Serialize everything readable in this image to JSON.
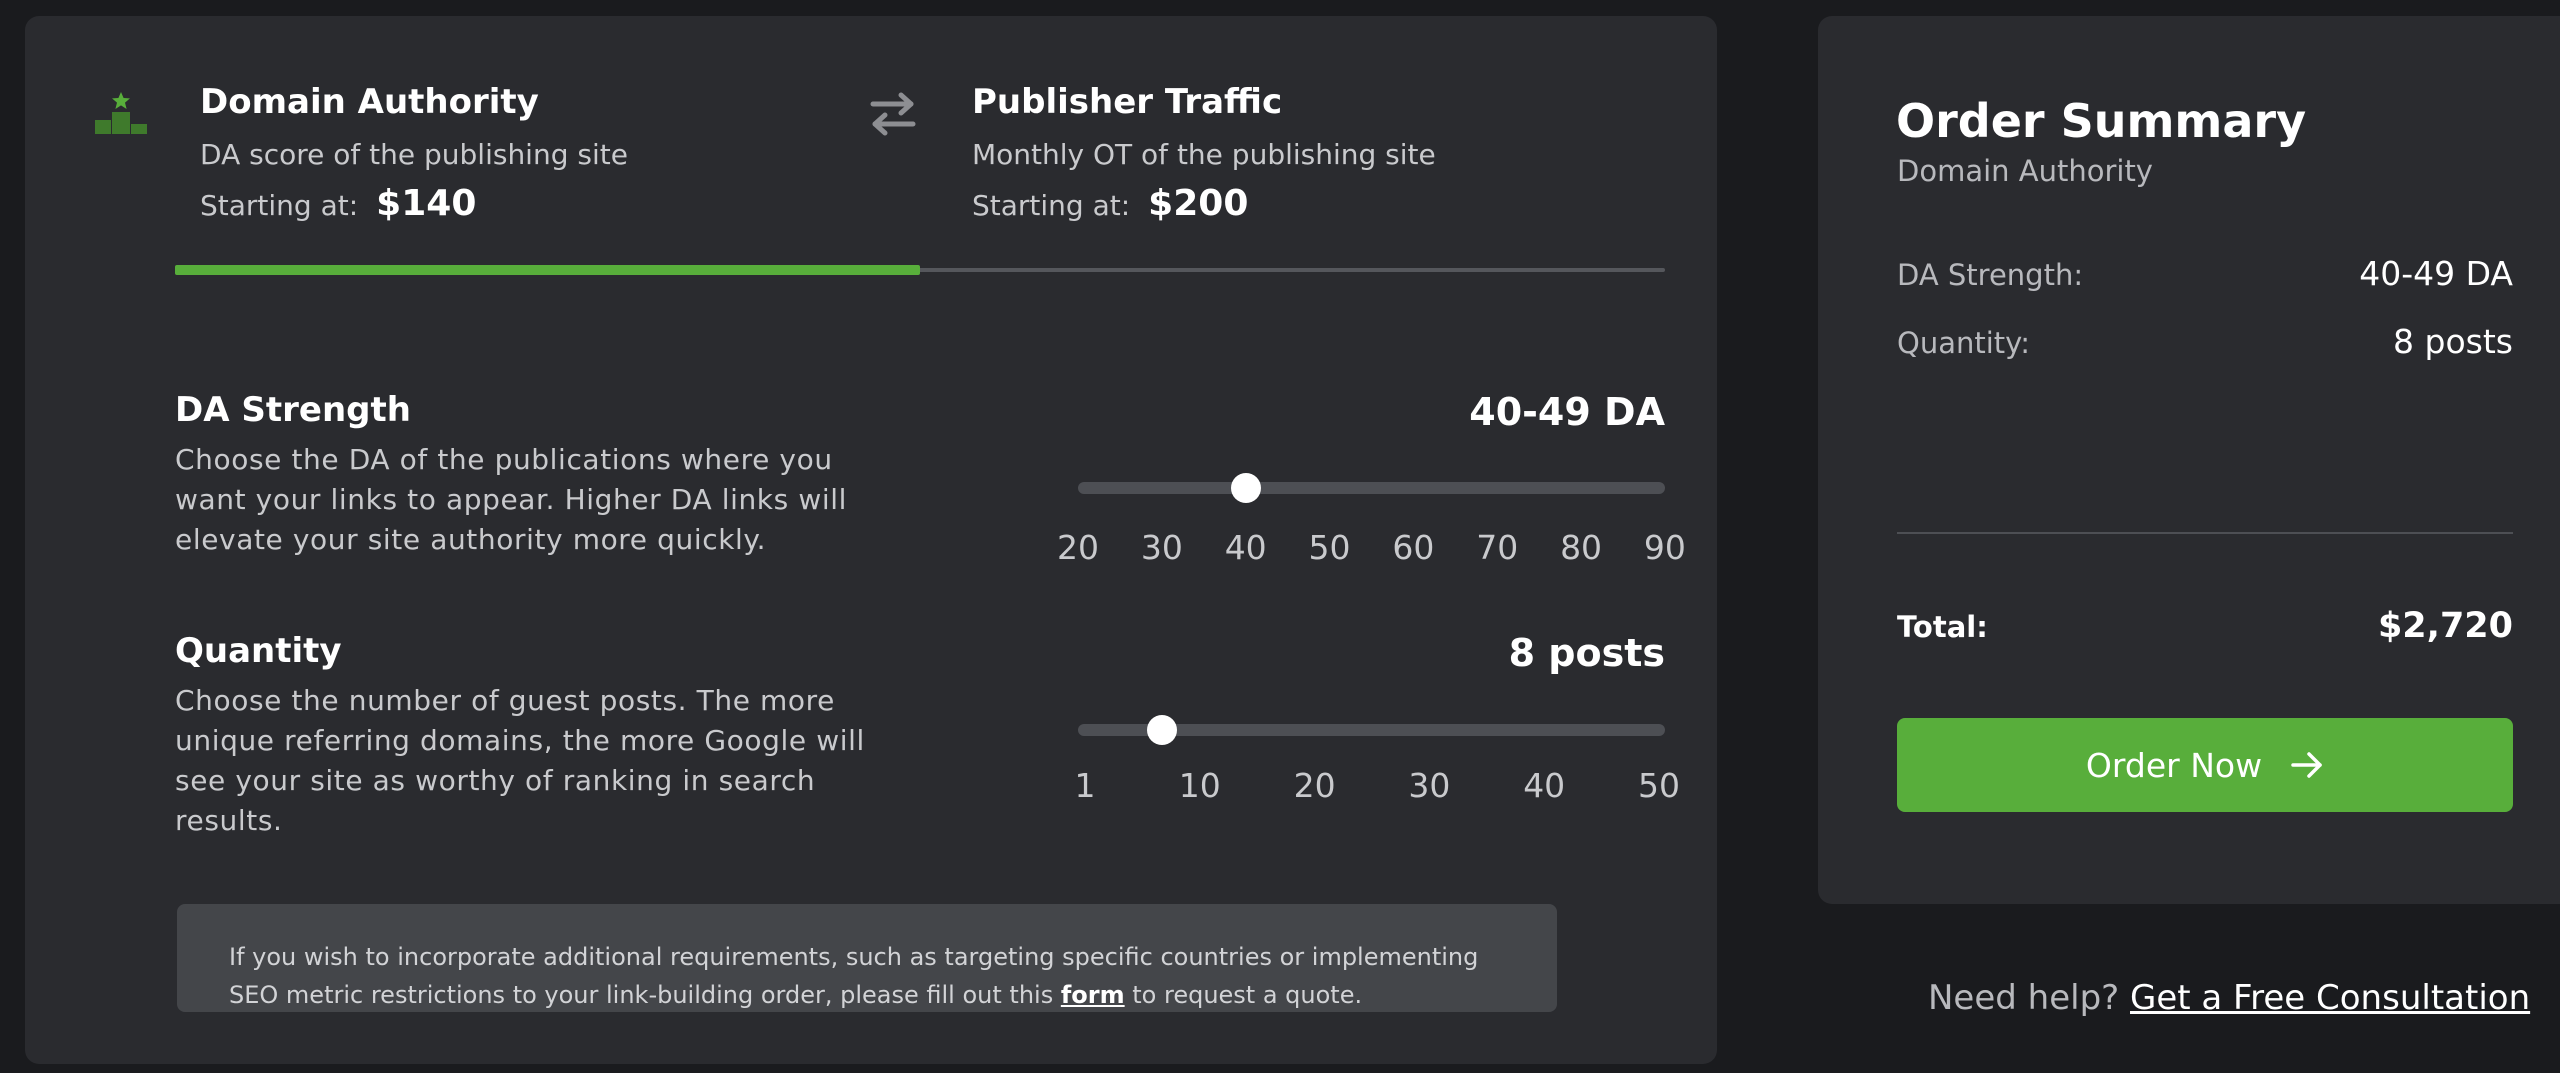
{
  "tabs": [
    {
      "title": "Domain Authority",
      "subtitle": "DA score of the publishing site",
      "price_label": "Starting at:",
      "price": "$140",
      "icon": "podium-star-icon",
      "selected": true
    },
    {
      "title": "Publisher Traffic",
      "subtitle": "Monthly OT of the publishing site",
      "price_label": "Starting at:",
      "price": "$200",
      "icon": "swap-arrows-icon",
      "selected": false
    }
  ],
  "tab_progress": 0.5,
  "options": {
    "da": {
      "title": "DA Strength",
      "description": "Choose the DA of the publications where you want your links to appear. Higher DA links will elevate your site authority more quickly.",
      "value": "40-49 DA",
      "ticks": [
        "20",
        "30",
        "40",
        "50",
        "60",
        "70",
        "80",
        "90"
      ],
      "slider_min": 20,
      "slider_max": 90,
      "slider_value": 40
    },
    "qty": {
      "title": "Quantity",
      "description": "Choose the number of guest posts. The more unique referring domains, the more Google will see your site as worthy of ranking in search results.",
      "value": "8 posts",
      "ticks": [
        "1",
        "10",
        "20",
        "30",
        "40",
        "50"
      ],
      "slider_min": 1,
      "slider_max": 50,
      "slider_value": 8
    }
  },
  "info": {
    "text_before": "If you wish to incorporate additional requirements, such as targeting specific countries or implementing SEO metric restrictions to your link-building order, please fill out this ",
    "link": "form",
    "text_after": " to request a quote."
  },
  "summary": {
    "title": "Order Summary",
    "subtitle": "Domain Authority",
    "rows": [
      {
        "label": "DA Strength:",
        "value": "40-49 DA"
      },
      {
        "label": "Quantity:",
        "value": "8 posts"
      }
    ],
    "total_label": "Total:",
    "total_value": "$2,720",
    "button_label": "Order Now"
  },
  "help": {
    "text": "Need help?",
    "link": "Get a Free Consultation"
  },
  "colors": {
    "accent": "#58ae3b",
    "card": "#2a2b2f",
    "background": "#1a1b1e"
  }
}
